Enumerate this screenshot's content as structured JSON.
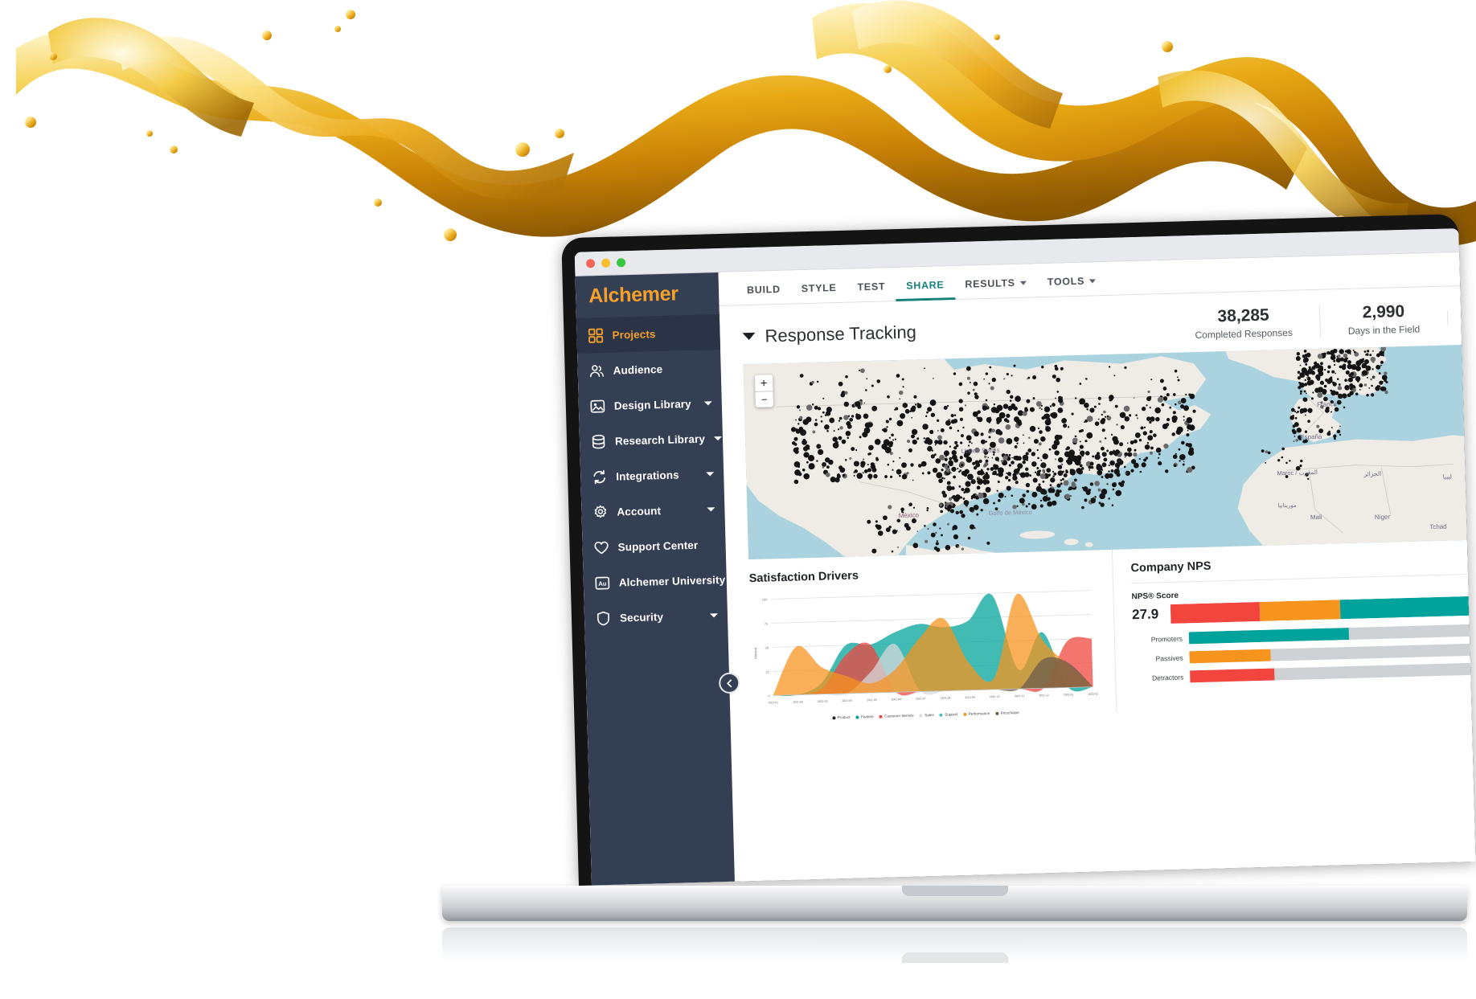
{
  "window": {
    "traffic_lights": [
      "close",
      "minimize",
      "maximize"
    ]
  },
  "sidebar": {
    "brand": "Alchemer",
    "items": [
      {
        "label": "Projects",
        "icon": "grid-icon",
        "active": true,
        "expandable": false
      },
      {
        "label": "Audience",
        "icon": "people-icon",
        "active": false,
        "expandable": false
      },
      {
        "label": "Design Library",
        "icon": "image-icon",
        "active": false,
        "expandable": true
      },
      {
        "label": "Research Library",
        "icon": "database-icon",
        "active": false,
        "expandable": true
      },
      {
        "label": "Integrations",
        "icon": "sync-icon",
        "active": false,
        "expandable": true
      },
      {
        "label": "Account",
        "icon": "gear-icon",
        "active": false,
        "expandable": true
      },
      {
        "label": "Support Center",
        "icon": "heart-icon",
        "active": false,
        "expandable": false
      },
      {
        "label": "Alchemer University",
        "icon": "au-badge-icon",
        "active": false,
        "expandable": false
      },
      {
        "label": "Security",
        "icon": "shield-icon",
        "active": false,
        "expandable": true
      }
    ],
    "collapse_icon": "chevron-left-icon"
  },
  "tabs": [
    {
      "label": "BUILD",
      "active": false,
      "dropdown": false
    },
    {
      "label": "STYLE",
      "active": false,
      "dropdown": false
    },
    {
      "label": "TEST",
      "active": false,
      "dropdown": false
    },
    {
      "label": "SHARE",
      "active": true,
      "dropdown": false
    },
    {
      "label": "RESULTS",
      "active": false,
      "dropdown": true
    },
    {
      "label": "TOOLS",
      "active": false,
      "dropdown": true
    }
  ],
  "response_tracking": {
    "title": "Response Tracking",
    "collapse_icon": "chevron-down-icon",
    "stats": [
      {
        "value": "38,285",
        "caption": "Completed Responses"
      },
      {
        "value": "2,990",
        "caption": "Days in the Field"
      }
    ]
  },
  "map": {
    "zoom_in_label": "+",
    "zoom_out_label": "−",
    "labels": [
      "United States",
      "México",
      "Golfo de México",
      "France",
      "España",
      "Maroc / المغرب",
      "الجزائر",
      "Mali",
      "Niger",
      "Tchad",
      "ليبيا",
      "موريتانيا"
    ],
    "ocean_color": "#aad3df",
    "land_color": "#efece6",
    "marker_color": "#1a1a1a"
  },
  "panels": {
    "satisfaction": {
      "title": "Satisfaction Drivers"
    },
    "nps": {
      "title": "Company NPS",
      "score_label": "NPS® Score",
      "score": "27.9",
      "segments": [
        {
          "name": "Detractors",
          "value": 30,
          "color": "#f2453d"
        },
        {
          "name": "Passives",
          "value": 27,
          "color": "#f7941e"
        },
        {
          "name": "Promoters",
          "value": 43,
          "color": "#00a39b"
        }
      ],
      "rows": [
        {
          "label": "Promoters",
          "value": 57,
          "color": "#00a39b"
        },
        {
          "label": "Passives",
          "value": 29,
          "color": "#f7941e"
        },
        {
          "label": "Detractors",
          "value": 30,
          "color": "#f2453d"
        }
      ]
    }
  },
  "chart_data": {
    "type": "area",
    "title": "Satisfaction Drivers",
    "xlabel": "",
    "ylabel": "Percent",
    "ylim": [
      0,
      100
    ],
    "yticks": [
      "0",
      "25",
      "50",
      "75",
      "100"
    ],
    "grid": true,
    "legend_position": "bottom",
    "categories": [
      "2021-01",
      "2021-02",
      "2021-03",
      "2021-04",
      "2021-05",
      "2021-06",
      "2021-07",
      "2021-08",
      "2021-09",
      "2021-10",
      "2021-11",
      "2021-12",
      "2022-01",
      "2022-02"
    ],
    "series": [
      {
        "name": "Product",
        "color": "#1f2226",
        "values": [
          0,
          0,
          0,
          0,
          0,
          0,
          0,
          0,
          0,
          0,
          0,
          0,
          0,
          0
        ]
      },
      {
        "name": "Feature",
        "color": "#00a39b",
        "values": [
          0,
          0,
          12,
          50,
          50,
          62,
          70,
          66,
          72,
          98,
          20,
          58,
          0,
          0
        ]
      },
      {
        "name": "Customer Service",
        "color": "#f2453d",
        "values": [
          0,
          0,
          6,
          40,
          50,
          0,
          0,
          0,
          0,
          0,
          0,
          0,
          48,
          50
        ]
      },
      {
        "name": "Sales",
        "color": "#d7d9dc",
        "values": [
          0,
          0,
          0,
          0,
          22,
          50,
          0,
          0,
          0,
          0,
          0,
          0,
          0,
          0
        ]
      },
      {
        "name": "Support",
        "color": "#4dbfb8",
        "values": [
          0,
          0,
          0,
          0,
          0,
          0,
          0,
          0,
          0,
          0,
          0,
          0,
          0,
          0
        ]
      },
      {
        "name": "Performance",
        "color": "#f7941e",
        "values": [
          0,
          50,
          28,
          18,
          10,
          24,
          55,
          75,
          28,
          12,
          98,
          50,
          24,
          0
        ]
      },
      {
        "name": "Price/Value",
        "color": "#6b5b4a",
        "values": [
          0,
          0,
          0,
          0,
          0,
          0,
          0,
          0,
          0,
          0,
          0,
          30,
          26,
          0
        ]
      }
    ]
  }
}
